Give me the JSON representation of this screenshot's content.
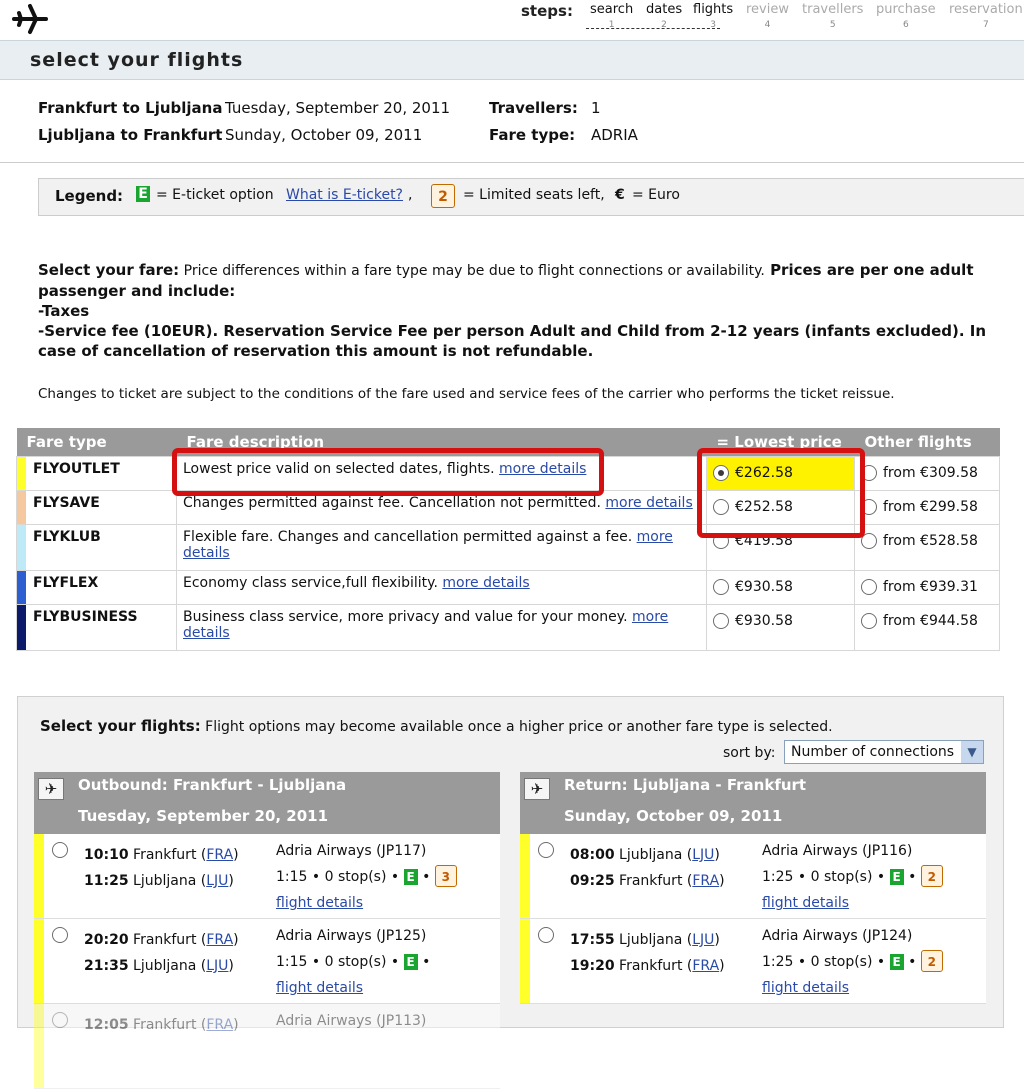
{
  "header": {
    "steps_label": "steps:",
    "steps": [
      {
        "name": "search",
        "num": "1",
        "active": true
      },
      {
        "name": "dates",
        "num": "2",
        "active": true
      },
      {
        "name": "flights",
        "num": "3",
        "active": true
      },
      {
        "name": "review",
        "num": "4",
        "active": false
      },
      {
        "name": "travellers",
        "num": "5",
        "active": false
      },
      {
        "name": "purchase",
        "num": "6",
        "active": false
      },
      {
        "name": "reservation",
        "num": "7",
        "active": false
      }
    ]
  },
  "page_title": "select your flights",
  "trip": {
    "leg1_route": "Frankfurt to Ljubljana",
    "leg1_date": "Tuesday, September 20, 2011",
    "leg2_route": "Ljubljana to Frankfurt",
    "leg2_date": "Sunday, October 09, 2011",
    "travellers_label": "Travellers:",
    "travellers_value": "1",
    "fare_type_label": "Fare type:",
    "fare_type_value": "ADRIA"
  },
  "legend": {
    "label": "Legend:",
    "e_badge": "E",
    "e_text": "= E-ticket option",
    "e_link": "What is E-ticket?",
    "comma1": ",",
    "seat_badge": "2",
    "seat_text": "= Limited seats left,",
    "euro_symbol": "€",
    "euro_text": "= Euro"
  },
  "fare_info": {
    "lead_bold": "Select your fare:",
    "lead_text": " Price differences within a fare type may be due to flight connections or availability.",
    "prices_bold": " Prices are per one adult passenger and include:",
    "taxes": "-Taxes",
    "service_fee": "-Service fee (10EUR). Reservation Service Fee per person Adult and Child from 2-12 years (infants excluded). In case of cancellation of reservation this amount is not refundable.",
    "changes_note": "Changes to ticket are subject to the conditions of the fare used and service fees of the carrier who performs the ticket reissue."
  },
  "fare_table": {
    "headers": {
      "fare_type": "Fare type",
      "fare_description": "Fare description",
      "lowest_price": "= Lowest price",
      "other_flights": "Other flights"
    },
    "rows": [
      {
        "name": "FLYOUTLET",
        "color": "#ffff2a",
        "desc": "Lowest price valid on selected dates, flights.",
        "link": "more details",
        "price": "€262.58",
        "checked": true,
        "other": "from €309.58"
      },
      {
        "name": "FLYSAVE",
        "color": "#f6c89f",
        "desc": "Changes permitted against fee. Cancellation not permitted.",
        "link": "more details",
        "price": "€252.58",
        "checked": false,
        "other": "from €299.58"
      },
      {
        "name": "FLYKLUB",
        "color": "#bdeaf6",
        "desc": "Flexible fare. Changes and cancellation permitted against a fee.",
        "link": "more details",
        "price": "€419.58",
        "checked": false,
        "other": "from €528.58"
      },
      {
        "name": "FLYFLEX",
        "color": "#2e5fd0",
        "desc": "Economy class service,full flexibility.",
        "link": "more details",
        "price": "€930.58",
        "checked": false,
        "other": "from €939.31"
      },
      {
        "name": "FLYBUSINESS",
        "color": "#0c1a6a",
        "desc": "Business class service, more privacy and value for your money.",
        "link": "more details",
        "price": "€930.58",
        "checked": false,
        "other": "from €944.58"
      }
    ]
  },
  "flights": {
    "intro_bold": "Select your flights:",
    "intro_text": " Flight options may become available once a higher price or another fare type is selected.",
    "sort_label": "sort by:",
    "sort_value": "Number of connections",
    "outbound": {
      "title": "Outbound: Frankfurt - Ljubljana",
      "date": "Tuesday, September 20, 2011",
      "rows": [
        {
          "dep_time": "10:10",
          "dep_city": "Frankfurt",
          "dep_code": "FRA",
          "arr_time": "11:25",
          "arr_city": "Ljubljana",
          "arr_code": "LJU",
          "airline": "Adria Airways (JP117)",
          "duration": "1:15",
          "stops": "0 stop(s)",
          "seats": "3",
          "details": "flight details"
        },
        {
          "dep_time": "20:20",
          "dep_city": "Frankfurt",
          "dep_code": "FRA",
          "arr_time": "21:35",
          "arr_city": "Ljubljana",
          "arr_code": "LJU",
          "airline": "Adria Airways (JP125)",
          "duration": "1:15",
          "stops": "0 stop(s)",
          "seats": "",
          "details": "flight details"
        },
        {
          "dep_time": "12:05",
          "dep_city": "Frankfurt",
          "dep_code": "FRA",
          "airline": "Adria Airways (JP113)"
        }
      ]
    },
    "return": {
      "title": "Return: Ljubljana - Frankfurt",
      "date": "Sunday, October 09, 2011",
      "rows": [
        {
          "dep_time": "08:00",
          "dep_city": "Ljubljana",
          "dep_code": "LJU",
          "arr_time": "09:25",
          "arr_city": "Frankfurt",
          "arr_code": "FRA",
          "airline": "Adria Airways (JP116)",
          "duration": "1:25",
          "stops": "0 stop(s)",
          "seats": "2",
          "details": "flight details"
        },
        {
          "dep_time": "17:55",
          "dep_city": "Ljubljana",
          "dep_code": "LJU",
          "arr_time": "19:20",
          "arr_city": "Frankfurt",
          "arr_code": "FRA",
          "airline": "Adria Airways (JP124)",
          "duration": "1:25",
          "stops": "0 stop(s)",
          "seats": "2",
          "details": "flight details"
        }
      ]
    },
    "bullet": "•",
    "e_badge": "E"
  }
}
